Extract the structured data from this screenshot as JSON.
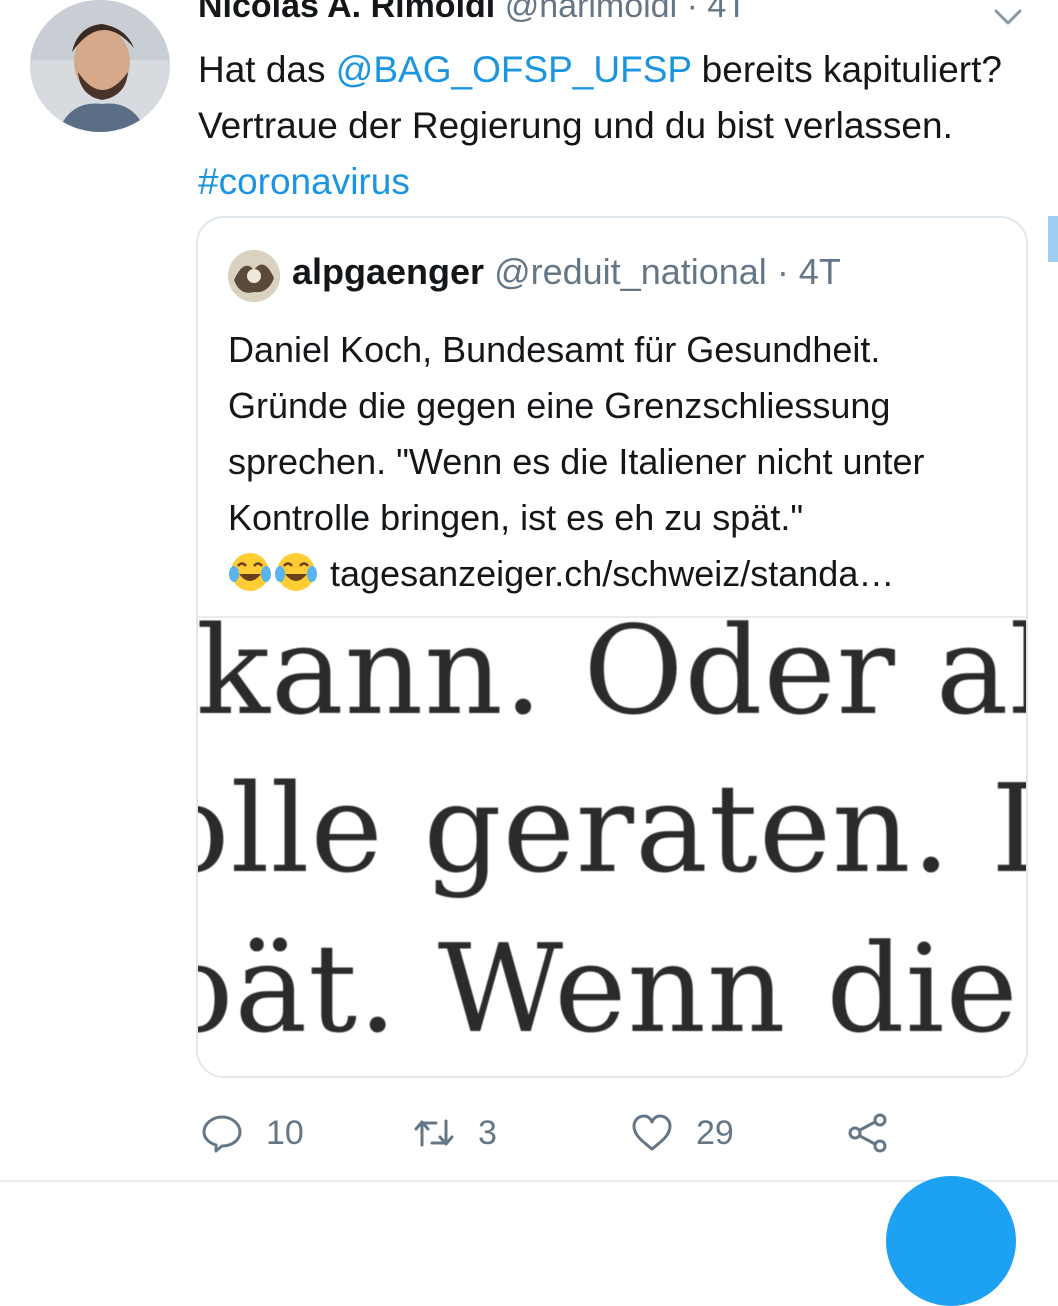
{
  "tweet": {
    "name": "Nicolas A. Rimoldi",
    "handle": "@narimoldi",
    "time": " · 4T",
    "text_part1": "Hat das ",
    "mention": "@BAG_OFSP_UFSP",
    "text_part2": " bereits kapituliert? Vertraue der Regierung und du bist verlassen. ",
    "hashtag": "#coronavirus"
  },
  "quoted": {
    "name": "alpgaenger",
    "handle": "@reduit_national",
    "time": " · 4T",
    "text": "Daniel Koch, Bundesamt für Gesundheit. Gründe die gegen eine Grenzschliessung sprechen. \"Wenn es die Italiener nicht unter Kontrolle bringen, ist es eh zu spät.\"",
    "emojis": [
      "tears-of-joy-emoji",
      "tears-of-joy-emoji"
    ],
    "link": "tagesanzeiger.ch/schweiz/standa…",
    "image_lines": [
      "kann. Oder aber",
      "olle geraten. In di",
      "oät. Wenn die Fal"
    ]
  },
  "actions": {
    "replies": "10",
    "retweets": "3",
    "likes": "29"
  },
  "colors": {
    "link": "#1b95e0",
    "muted": "#657786",
    "border": "#e1e8ed",
    "fab": "#1da1f2"
  }
}
